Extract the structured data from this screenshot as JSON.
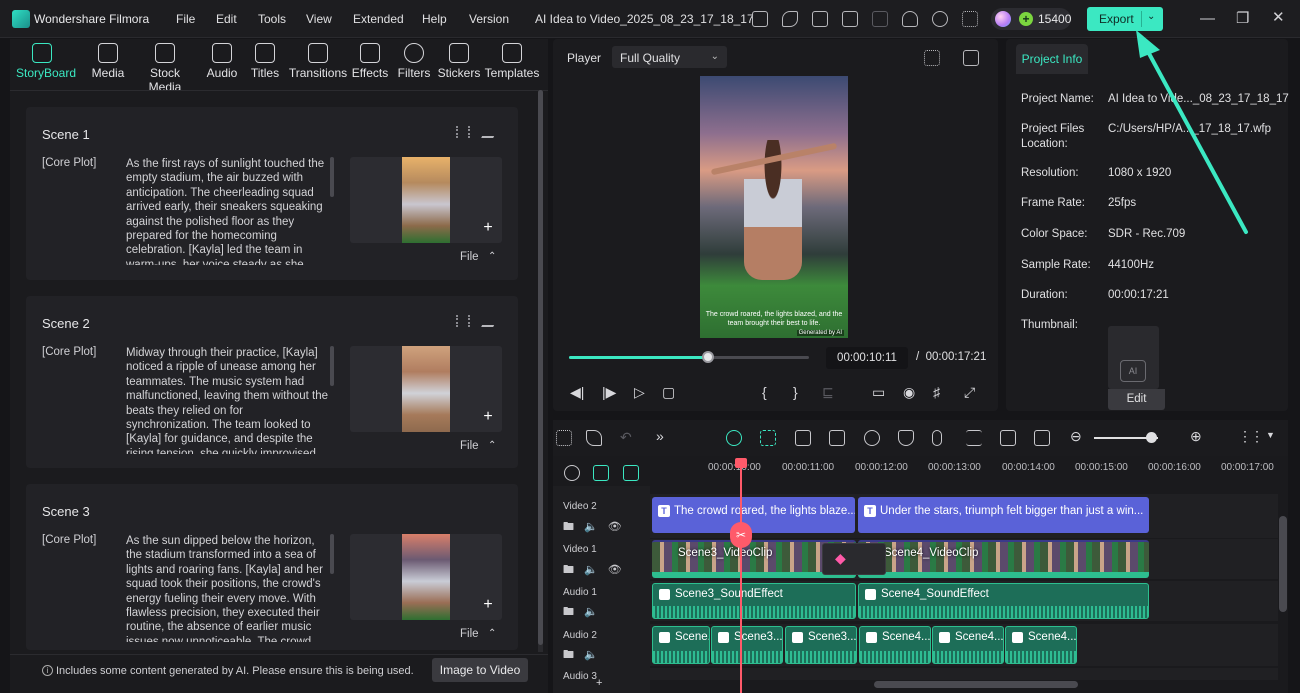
{
  "app": {
    "name": "Wondershare Filmora",
    "project_title": "AI Idea to Video_2025_08_23_17_18_17"
  },
  "menu": [
    "File",
    "Edit",
    "Tools",
    "View",
    "Extended",
    "Help",
    "Version"
  ],
  "credits": "15400",
  "export": {
    "label": "Export"
  },
  "toolbar": [
    {
      "label": "StoryBoard",
      "icon": "storyboard-icon",
      "active": true
    },
    {
      "label": "Media",
      "icon": "media-icon"
    },
    {
      "label": "Stock Media",
      "icon": "stock-media-icon"
    },
    {
      "label": "Audio",
      "icon": "audio-icon"
    },
    {
      "label": "Titles",
      "icon": "titles-icon"
    },
    {
      "label": "Transitions",
      "icon": "transitions-icon"
    },
    {
      "label": "Effects",
      "icon": "effects-icon"
    },
    {
      "label": "Filters",
      "icon": "filters-icon"
    },
    {
      "label": "Stickers",
      "icon": "stickers-icon"
    },
    {
      "label": "Templates",
      "icon": "templates-icon"
    }
  ],
  "scenes": [
    {
      "title": "Scene 1",
      "tag": "[Core Plot]",
      "text": "As the first rays of sunlight touched the empty stadium, the air buzzed with anticipation. The cheerleading squad arrived early, their sneakers squeaking against the polished floor as they prepared for the homecoming celebration. [Kayla] led the team in warm-ups, her voice steady as she",
      "file": "File"
    },
    {
      "title": "Scene 2",
      "tag": "[Core Plot]",
      "text": "Midway through their practice, [Kayla] noticed a ripple of unease among her teammates. The music system had malfunctioned, leaving them without the beats they relied on for synchronization. The team looked to [Kayla] for guidance, and despite the rising tension, she quickly improvised",
      "file": "File"
    },
    {
      "title": "Scene 3",
      "tag": "[Core Plot]",
      "text": "As the sun dipped below the horizon, the stadium transformed into a sea of lights and roaring fans. [Kayla] and her squad took their positions, the crowd's energy fueling their every move. With flawless precision, they executed their routine, the absence of earlier music issues now unnoticeable. The crowd",
      "file": "File"
    }
  ],
  "ai_note": "Includes some content generated by AI. Please ensure this is being used.",
  "image_to_video": "Image to Video",
  "player": {
    "label": "Player",
    "quality": "Full Quality",
    "caption": "The crowd roared, the lights blazed, and the team brought their best to life.",
    "badge": "Generated by AI",
    "current_time": "00:00:10:11",
    "separator": "/",
    "total_time": "00:00:17:21",
    "progress": 0.58
  },
  "project_info": {
    "tab": "Project Info",
    "rows": [
      {
        "label": "Project Name:",
        "value": "AI Idea to Vide..._08_23_17_18_17"
      },
      {
        "label": "Project Files Location:",
        "value": "C:/Users/HP/A..._17_18_17.wfp"
      },
      {
        "label": "Resolution:",
        "value": "1080 x 1920"
      },
      {
        "label": "Frame Rate:",
        "value": "25fps"
      },
      {
        "label": "Color Space:",
        "value": "SDR - Rec.709"
      },
      {
        "label": "Sample Rate:",
        "value": "44100Hz"
      },
      {
        "label": "Duration:",
        "value": "00:00:17:21"
      },
      {
        "label": "Thumbnail:",
        "value": ""
      }
    ],
    "edit": "Edit"
  },
  "timeline": {
    "ruler": [
      "00:00:10:00",
      "00:00:11:00",
      "00:00:12:00",
      "00:00:13:00",
      "00:00:14:00",
      "00:00:15:00",
      "00:00:16:00",
      "00:00:17:00"
    ],
    "tracks": [
      "Video 2",
      "Video 1",
      "Audio 1",
      "Audio 2",
      "Audio 3"
    ],
    "title_clips": [
      "The crowd roared, the lights blaze...",
      "Under the stars, triumph felt bigger than just a win..."
    ],
    "video_clips": [
      "Scene3_VideoClip",
      "Scene4_VideoClip"
    ],
    "audio1_clips": [
      "Scene3_SoundEffect",
      "Scene4_SoundEffect"
    ],
    "audio2_clips": [
      "Scene...",
      "Scene3...",
      "Scene3...",
      "Scene4...",
      "Scene4...",
      "Scene4..."
    ]
  }
}
